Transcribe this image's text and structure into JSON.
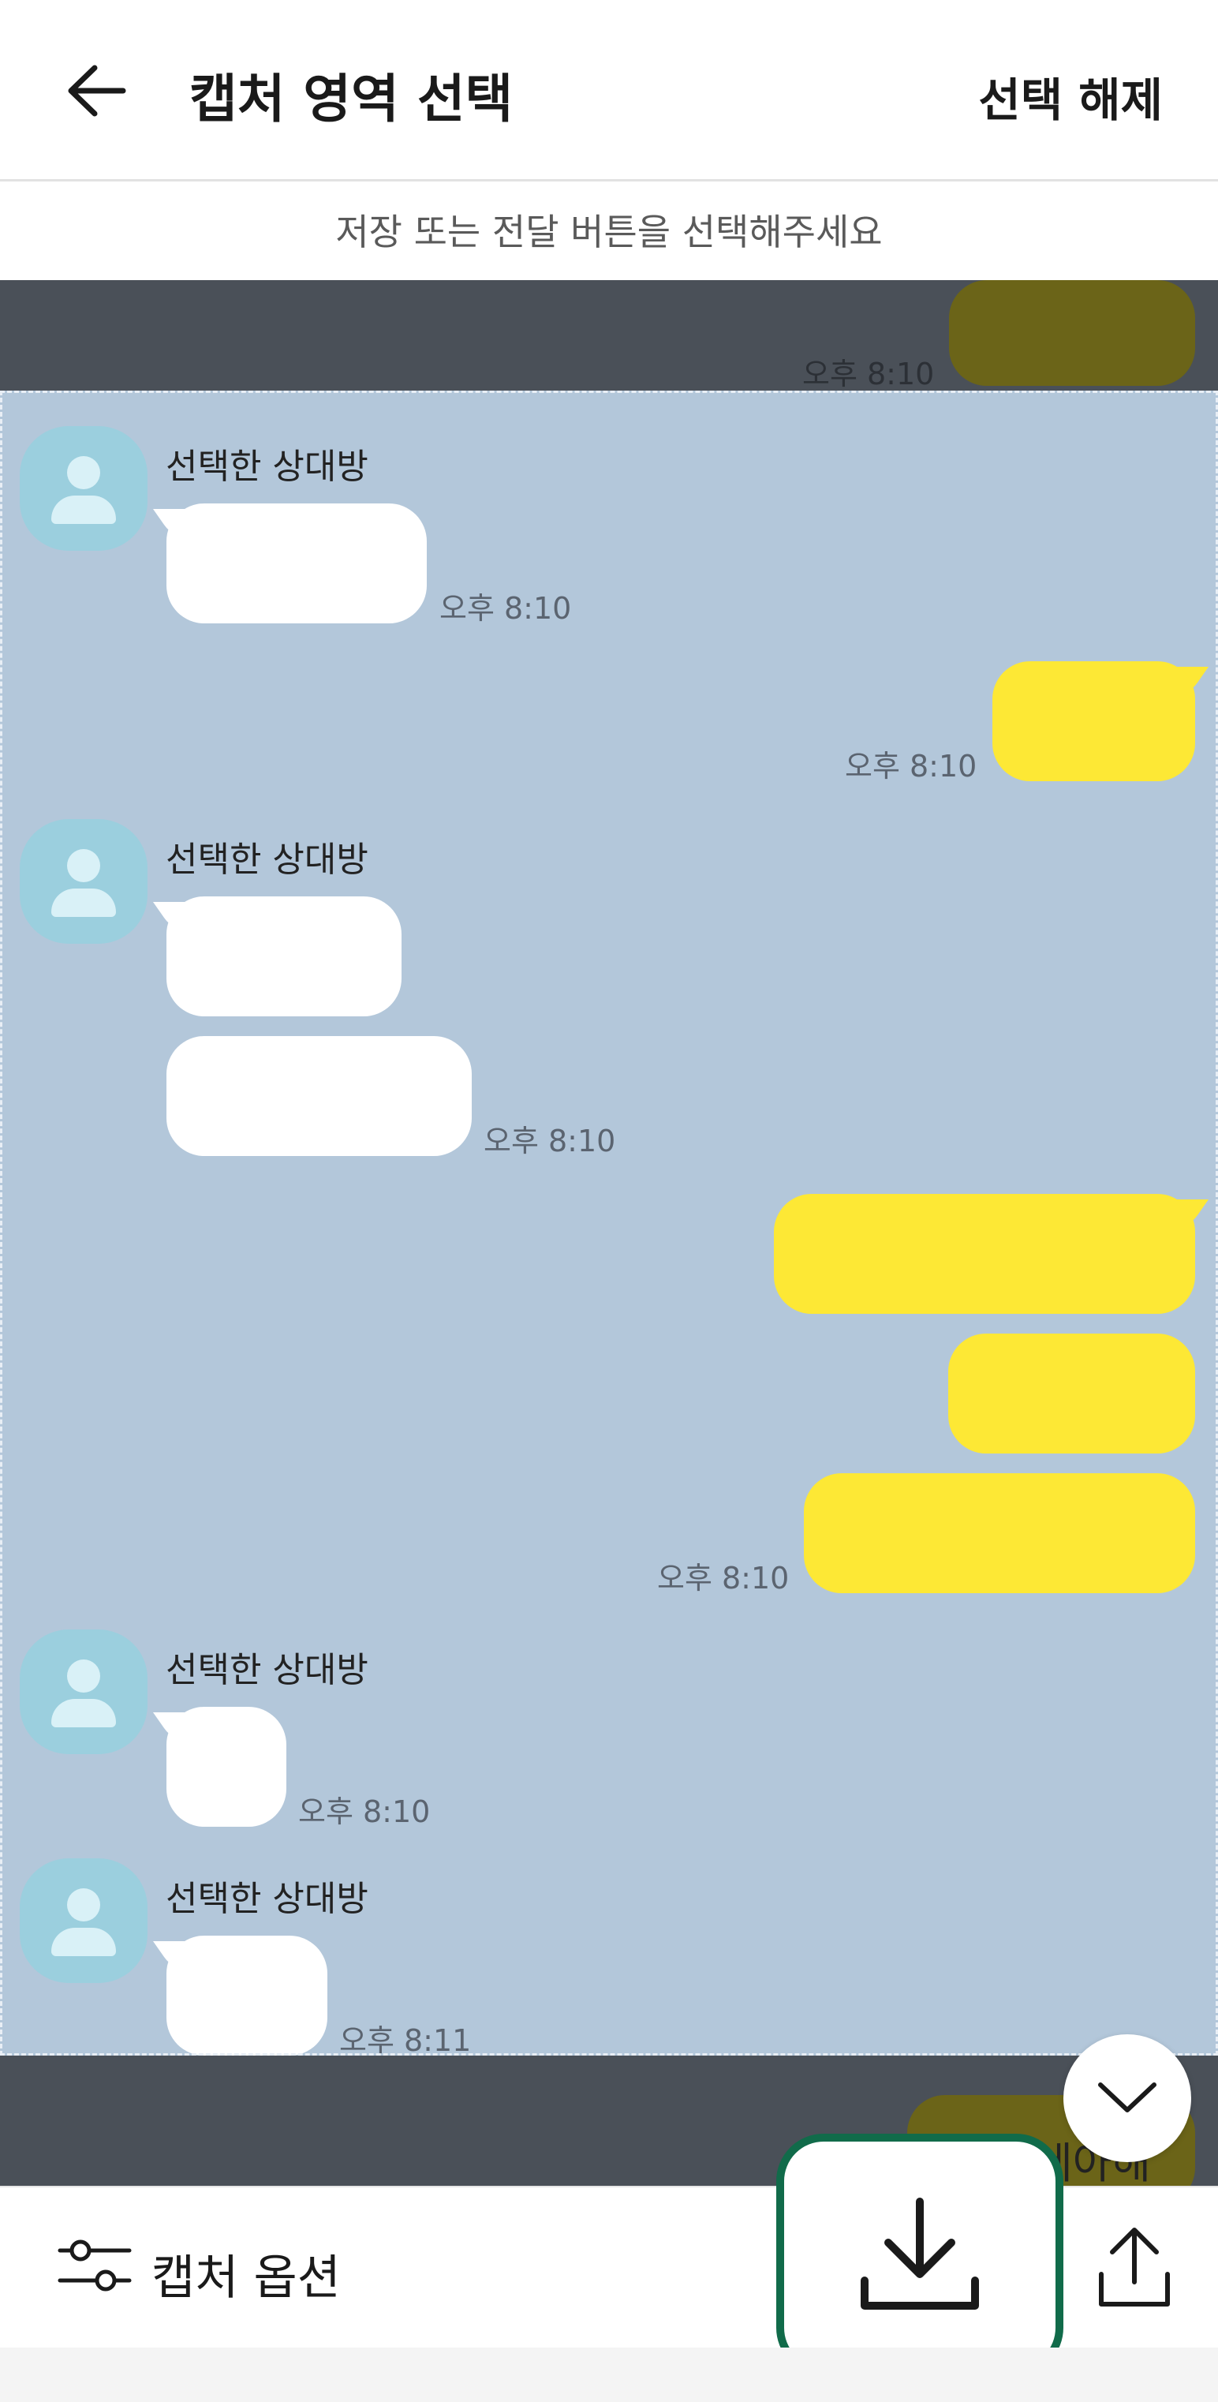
{
  "header": {
    "title": "캡처 영역 선택",
    "deselect_label": "선택 해제"
  },
  "hint": "저장 또는 전달 버튼을 선택해주세요",
  "chat": {
    "partner_name": "선택한 상대방",
    "top_time": "오후 8:10",
    "times": {
      "g1_in": "오후 8:10",
      "g1_out": "오후 8:10",
      "g2_in": "오후 8:10",
      "g2_out": "오후 8:10",
      "g3_in": "오후 8:10",
      "g4_in": "오후 8:11"
    },
    "bottom_partial_text": "세아해"
  },
  "bottom": {
    "capture_options_label": "캡처 옵션"
  },
  "colors": {
    "chat_bg": "#b3c7da",
    "dim": "#4a5058",
    "my_bubble": "#fde835",
    "accent_border": "#116b4a"
  }
}
